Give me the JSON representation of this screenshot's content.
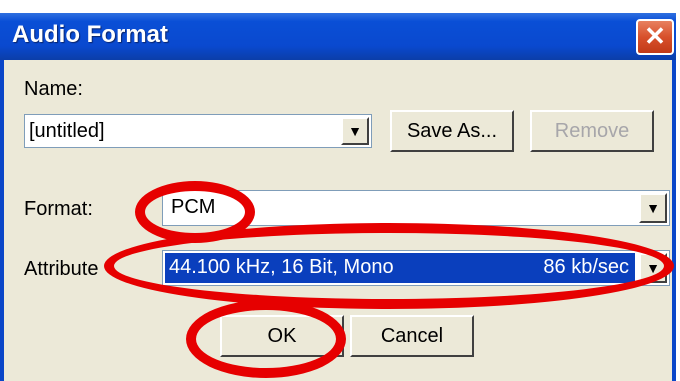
{
  "window": {
    "title": "Audio Format",
    "close_icon": "close-icon"
  },
  "name_section": {
    "label": "Name:",
    "value": "[untitled]",
    "save_as_label": "Save As...",
    "remove_label": "Remove"
  },
  "format_section": {
    "label": "Format:",
    "value": "PCM"
  },
  "attributes_section": {
    "label": "Attribute",
    "value": "44.100 kHz, 16 Bit, Mono",
    "bitrate": "86 kb/sec"
  },
  "buttons": {
    "ok_label": "OK",
    "cancel_label": "Cancel"
  },
  "annotation": {
    "color": "#e60000"
  }
}
